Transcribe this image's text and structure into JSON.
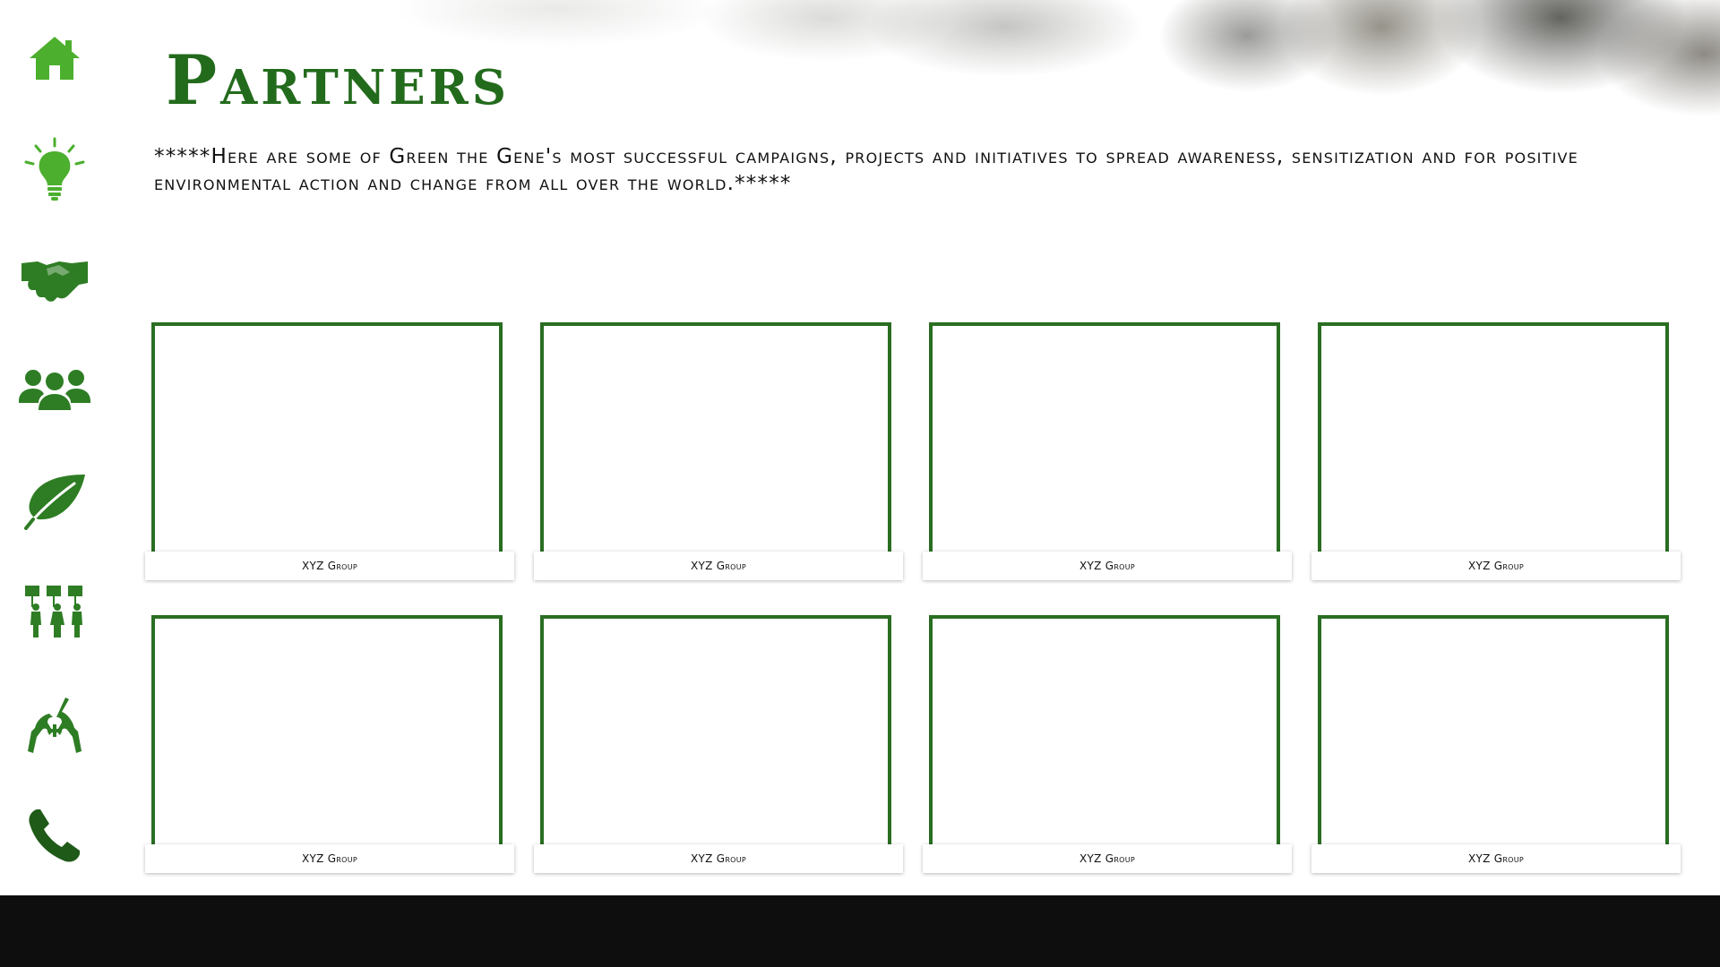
{
  "page": {
    "title": "Partners",
    "intro": "*****Here are some of Green the Gene's most successful campaigns, projects and initiatives to spread awareness, sensitization and for positive environmental action and change from all over the world.*****"
  },
  "sidebar": {
    "items": [
      {
        "icon": "home-icon"
      },
      {
        "icon": "lightbulb-icon"
      },
      {
        "icon": "handshake-icon"
      },
      {
        "icon": "people-group-icon"
      },
      {
        "icon": "leaf-icon"
      },
      {
        "icon": "protesters-icon"
      },
      {
        "icon": "hands-plus-icon"
      },
      {
        "icon": "phone-icon"
      }
    ]
  },
  "partners": [
    {
      "name": "XYZ Group"
    },
    {
      "name": "XYZ Group"
    },
    {
      "name": "XYZ Group"
    },
    {
      "name": "XYZ Group"
    },
    {
      "name": "XYZ Group"
    },
    {
      "name": "XYZ Group"
    },
    {
      "name": "XYZ Group"
    },
    {
      "name": "XYZ Group"
    }
  ],
  "colors": {
    "accent_green": "#2a6e22",
    "light_green": "#4caf2e",
    "dark_green": "#1f5a18",
    "footer": "#0e0e0e"
  }
}
